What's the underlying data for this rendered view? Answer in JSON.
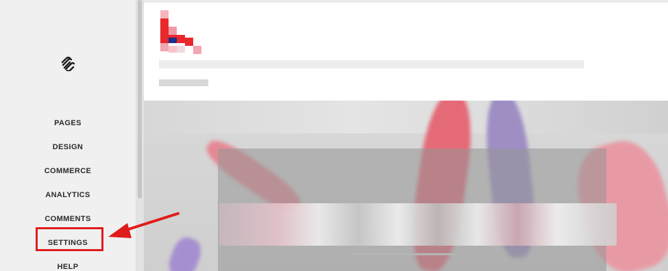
{
  "sidebar": {
    "logo_icon": "squarespace-logo-icon",
    "items": [
      {
        "label": "PAGES"
      },
      {
        "label": "DESIGN"
      },
      {
        "label": "COMMERCE"
      },
      {
        "label": "ANALYTICS"
      },
      {
        "label": "COMMENTS"
      },
      {
        "label": "SETTINGS",
        "highlighted": true
      },
      {
        "label": "HELP"
      }
    ]
  },
  "annotation": {
    "arrow_icon": "red-arrow-icon",
    "color": "#e01b1b"
  },
  "preview": {
    "brand_colors": [
      "#e8282b",
      "#f2a6b0",
      "#1b2f8c"
    ]
  }
}
